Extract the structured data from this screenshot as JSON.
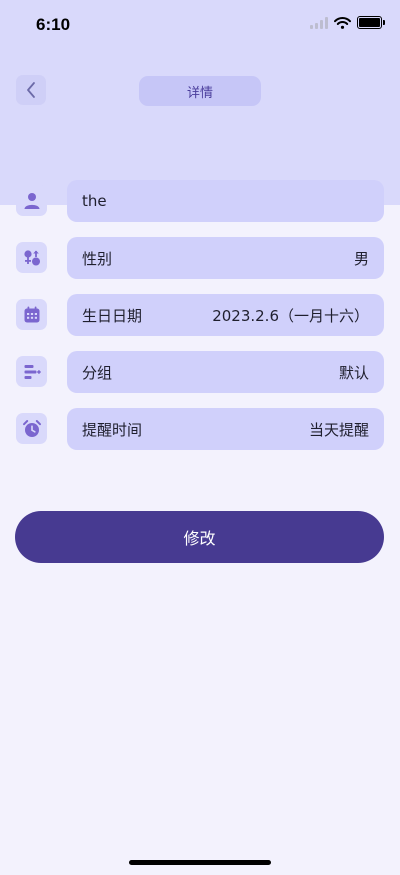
{
  "status_bar": {
    "time": "6:10"
  },
  "header": {
    "title": "详情",
    "back_icon": "chevron-left-icon"
  },
  "colors": {
    "accent": "#473a91",
    "header_bg": "#d9d9fb",
    "field_bg": "#d0d0fb",
    "page_bg": "#f3f2fd",
    "icon_color": "#7b66cf"
  },
  "form": {
    "name": {
      "icon": "person-icon",
      "value": "the"
    },
    "gender": {
      "icon": "gender-icon",
      "label": "性别",
      "value": "男"
    },
    "birthday": {
      "icon": "calendar-icon",
      "label": "生日日期",
      "value": "2023.2.6（一月十六）"
    },
    "group": {
      "icon": "group-icon",
      "label": "分组",
      "value": "默认"
    },
    "reminder": {
      "icon": "alarm-clock-icon",
      "label": "提醒时间",
      "value": "当天提醒"
    }
  },
  "actions": {
    "submit_label": "修改"
  }
}
